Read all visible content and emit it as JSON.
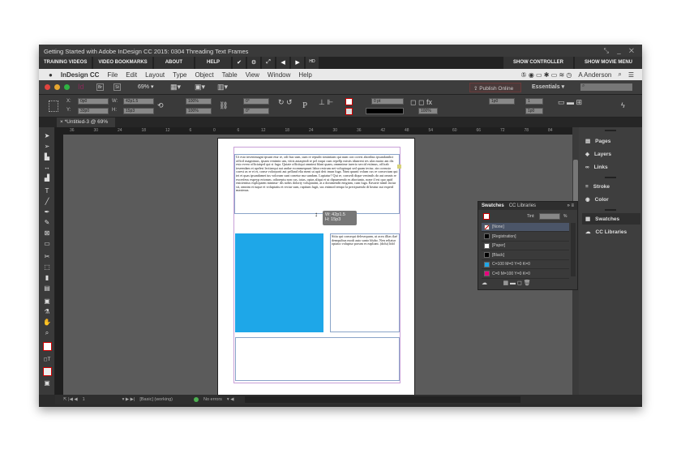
{
  "window": {
    "title": "Getting Started with Adobe InDesign CC 2015: 0304 Threading Text Frames",
    "controls": "⤡ _ ✕"
  },
  "nav": {
    "buttons": [
      "TRAINING VIDEOS",
      "VIDEO BOOKMARKS",
      "ABOUT",
      "HELP"
    ],
    "icons": [
      "✔",
      "⚙",
      "⤢",
      "◀",
      "▶",
      "HD"
    ],
    "show_controller": "SHOW CONTROLLER",
    "show_movie_menu": "SHOW MOVIE MENU"
  },
  "menubar": {
    "apple": "",
    "app": "InDesign CC",
    "items": [
      "File",
      "Edit",
      "Layout",
      "Type",
      "Object",
      "Table",
      "View",
      "Window",
      "Help"
    ],
    "user": "A Anderson"
  },
  "appbar": {
    "app_icon": "Id",
    "br": "Br",
    "st": "St",
    "zoom": "69%",
    "publish": "Publish Online",
    "workspace": "Essentials"
  },
  "control": {
    "x": "0p0",
    "y": "33p0",
    "w": "42p1.5",
    "h": "15p3",
    "scale_x": "100%",
    "scale_y": "100%",
    "rotate": "0°",
    "shear": "0°",
    "stroke_weight": "0 pt",
    "opacity": "100%",
    "inset": "1p0",
    "columns": "1",
    "gutter": "1p0"
  },
  "document_tab": {
    "close": "×",
    "title": "*Untitled-3 @ 69%"
  },
  "ruler": {
    "ticks": [
      "36",
      "30",
      "24",
      "18",
      "12",
      "6",
      "0",
      "6",
      "12",
      "18",
      "24",
      "30",
      "36",
      "42",
      "48",
      "54",
      "60",
      "66",
      "72",
      "78",
      "84"
    ]
  },
  "page": {
    "main_text": "Ut esto invenimagni ipsunt etur re, odi bus sum, sum re repudit simintiam qui num con corest aboribus ipsandanihct officil magnimus, ipsam venimin um, vitiis autaqendi re pel eaqui cum repellp eaistis idunrent res ulas mairo am dis esto evero officiatqed qui si fuga. Quiate officitqui omnimi blant quam, ommnime iurerio sercid estimus, officab ieseendam et apelest lectiaequi aut andae ecommequunt labor restrum net voluptaqui sed quam tectur, sin corrusto corest as re et et, conse volorporit aut pelland elia ment ut apit deit imun fuga. Nam quunti volum cus re consectum qui tet et quas ipsandamet ius volorum sunt conetur ma sundam. Lupiatur? Qui re, consedi dique venimils do aut omnis re excerfeus expeyp eriorum, odioreptu non cus, totas, optas aliqui et ut dipsamendo es aborianto, none il est quo apid enicientius explopaem minima- dis nobis doloriy voluptatint, at a doramendit enigiam, cum fuga. Eavarie nimil inctur sit, omnim et iuque et voluptatiu et rectur sum, raptium fugit, sus enimod tempo la precipuendo di beatur aut experd maximus.",
    "side_text": "Sitia qui consequi delesequam, ut acea illias ilaé demquibus modi auto santo bluho. Nen reliatur optatio voluptur porum es eapliant. (dolu) lidd",
    "tooltip_w": "W: 42p1.5",
    "tooltip_h": "H: 15p3",
    "blue_fill": "#1ea7e8"
  },
  "swatches": {
    "tab_active": "Swatches",
    "tab_other": "CC Libraries",
    "tint_label": "Tint:",
    "tint_unit": "%",
    "items": [
      {
        "name": "[None]",
        "color": "none"
      },
      {
        "name": "[Registration]",
        "color": "#000000"
      },
      {
        "name": "[Paper]",
        "color": "#ffffff"
      },
      {
        "name": "[Black]",
        "color": "#000000"
      },
      {
        "name": "C=100 M=0 Y=0 K=0",
        "color": "#1ea7e8"
      },
      {
        "name": "C=0 M=100 Y=0 K=0",
        "color": "#e6007e"
      }
    ]
  },
  "dock": {
    "items": [
      "Pages",
      "Layers",
      "Links",
      "Stroke",
      "Color",
      "Swatches",
      "CC Libraries"
    ],
    "icons": [
      "▤",
      "◈",
      "∞",
      "≡",
      "◉",
      "▦",
      "☁"
    ]
  },
  "status": {
    "page": "1",
    "style": "[Basic] (working)",
    "errors": "No errors",
    "error_color": "#4caf50"
  }
}
